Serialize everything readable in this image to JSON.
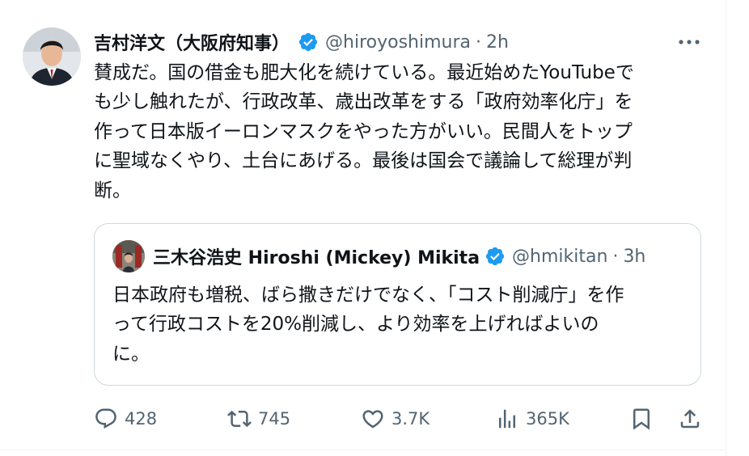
{
  "tweet": {
    "author_name": "吉村洋文（大阪府知事）",
    "handle": "@hiroyoshimura",
    "separator": "·",
    "time": "2h",
    "text": "賛成だ。国の借金も肥大化を続けている。最近始めたYouTubeで\nも少し触れたが、行政改革、歳出改革をする「政府効率化庁」を\n作って日本版イーロンマスクをやった方がいい。民間人をトップ\nに聖域なくやり、土台にあげる。最後は国会で議論して総理が判\n断。"
  },
  "quote": {
    "author_name": "三木谷浩史 Hiroshi (Mickey) Mikita",
    "handle": "@hmikitan",
    "separator": "·",
    "time": "3h",
    "text": "日本政府も増税、ばら撒きだけでなく、「コスト削減庁」を作\nって行政コストを20%削減し、より効率を上げればよいの\nに。"
  },
  "actions": {
    "replies": "428",
    "reposts": "745",
    "likes": "3.7K",
    "views": "365K"
  },
  "icons": {
    "verified": "verified-badge-icon",
    "more": "more-horizontal-icon",
    "reply": "reply-icon",
    "repost": "repost-icon",
    "like": "heart-icon",
    "views": "views-bar-chart-icon",
    "bookmark": "bookmark-icon",
    "share": "share-icon"
  },
  "colors": {
    "text": "#0f1419",
    "secondary": "#536471",
    "verified": "#1d9bf0",
    "border": "#cfd9de"
  }
}
